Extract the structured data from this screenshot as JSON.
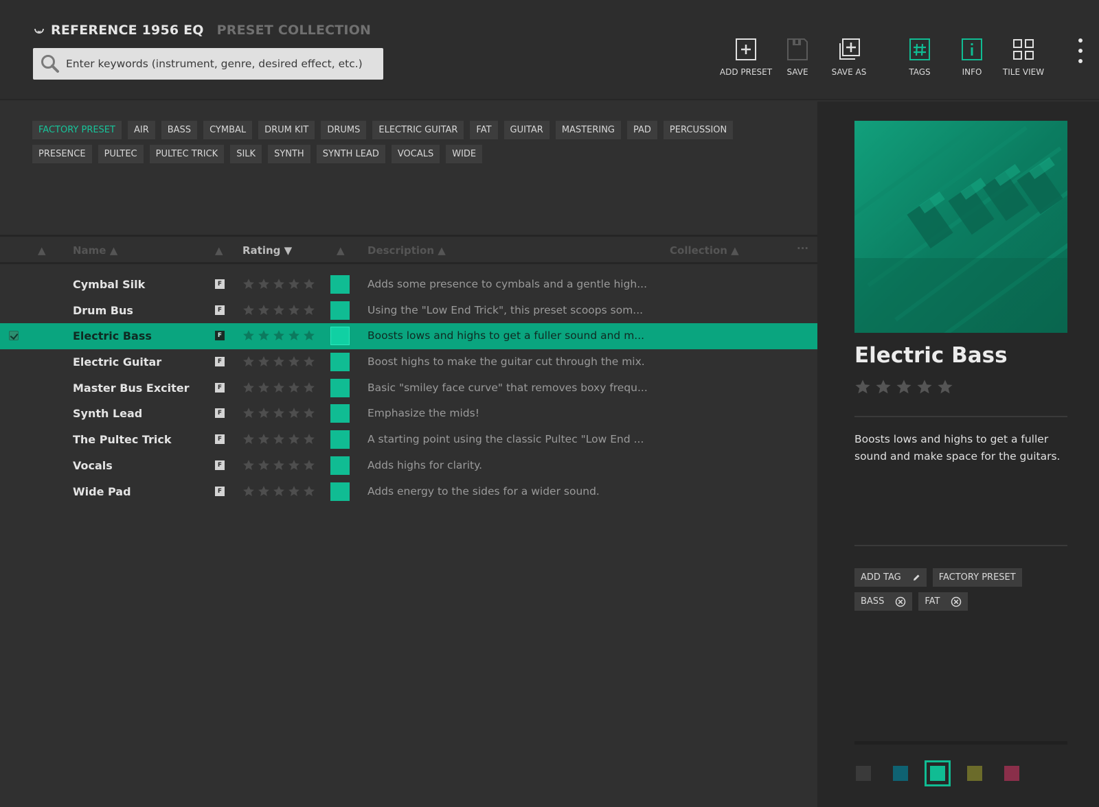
{
  "header": {
    "app_title": "REFERENCE 1956 EQ",
    "app_subtitle": "PRESET COLLECTION",
    "search_placeholder": "Enter keywords (instrument, genre, desired effect, etc.)"
  },
  "toolbar": {
    "add_preset": "ADD PRESET",
    "save": "SAVE",
    "save_as": "SAVE AS",
    "tags": "TAGS",
    "info": "INFO",
    "tile_view": "TILE VIEW"
  },
  "tags": [
    "FACTORY PRESET",
    "AIR",
    "BASS",
    "CYMBAL",
    "DRUM KIT",
    "DRUMS",
    "ELECTRIC GUITAR",
    "FAT",
    "GUITAR",
    "MASTERING",
    "PAD",
    "PERCUSSION",
    "PRESENCE",
    "PULTEC",
    "PULTEC TRICK",
    "SILK",
    "SYNTH",
    "SYNTH LEAD",
    "VOCALS",
    "WIDE"
  ],
  "active_tag": "FACTORY PRESET",
  "columns": {
    "name": "Name ▲",
    "rating": "Rating ▼",
    "description": "Description ▲",
    "collection": "Collection ▲",
    "more": "···",
    "sort_a": "▲",
    "sort_b": "▲",
    "sort_c": "▲"
  },
  "presets": [
    {
      "name": "Cymbal Silk",
      "badge": "F",
      "rating": 0,
      "description": "Adds some presence to cymbals and a gentle high...",
      "selected": false
    },
    {
      "name": "Drum Bus",
      "badge": "F",
      "rating": 0,
      "description": "Using the \"Low End Trick\", this preset scoops som...",
      "selected": false
    },
    {
      "name": "Electric Bass",
      "badge": "F",
      "rating": 0,
      "description": "Boosts lows and highs to get a fuller sound and m...",
      "selected": true
    },
    {
      "name": "Electric Guitar",
      "badge": "F",
      "rating": 0,
      "description": "Boost highs to make the guitar cut through the mix.",
      "selected": false
    },
    {
      "name": "Master Bus Exciter",
      "badge": "F",
      "rating": 0,
      "description": "Basic \"smiley face curve\" that removes boxy frequ...",
      "selected": false
    },
    {
      "name": "Synth Lead",
      "badge": "F",
      "rating": 0,
      "description": "Emphasize the mids!",
      "selected": false
    },
    {
      "name": "The Pultec Trick",
      "badge": "F",
      "rating": 0,
      "description": "A starting point using the classic Pultec \"Low End ...",
      "selected": false
    },
    {
      "name": "Vocals",
      "badge": "F",
      "rating": 0,
      "description": "Adds highs for clarity.",
      "selected": false
    },
    {
      "name": "Wide Pad",
      "badge": "F",
      "rating": 0,
      "description": "Adds energy to the sides for a wider sound.",
      "selected": false
    }
  ],
  "detail": {
    "title": "Electric Bass",
    "rating": 0,
    "description": "Boosts lows and highs to get a fuller sound and make space for the guitars.",
    "add_tag": "ADD TAG",
    "tags": [
      "FACTORY PRESET",
      "BASS",
      "FAT"
    ],
    "colors": [
      "#3a3a3a",
      "#0f6272",
      "#10bc93",
      "#6b6b2a",
      "#8a2f4a"
    ],
    "selected_color": "#10bc93"
  },
  "theme": {
    "accent": "#0aa57f",
    "swatch": "#10bc93"
  }
}
